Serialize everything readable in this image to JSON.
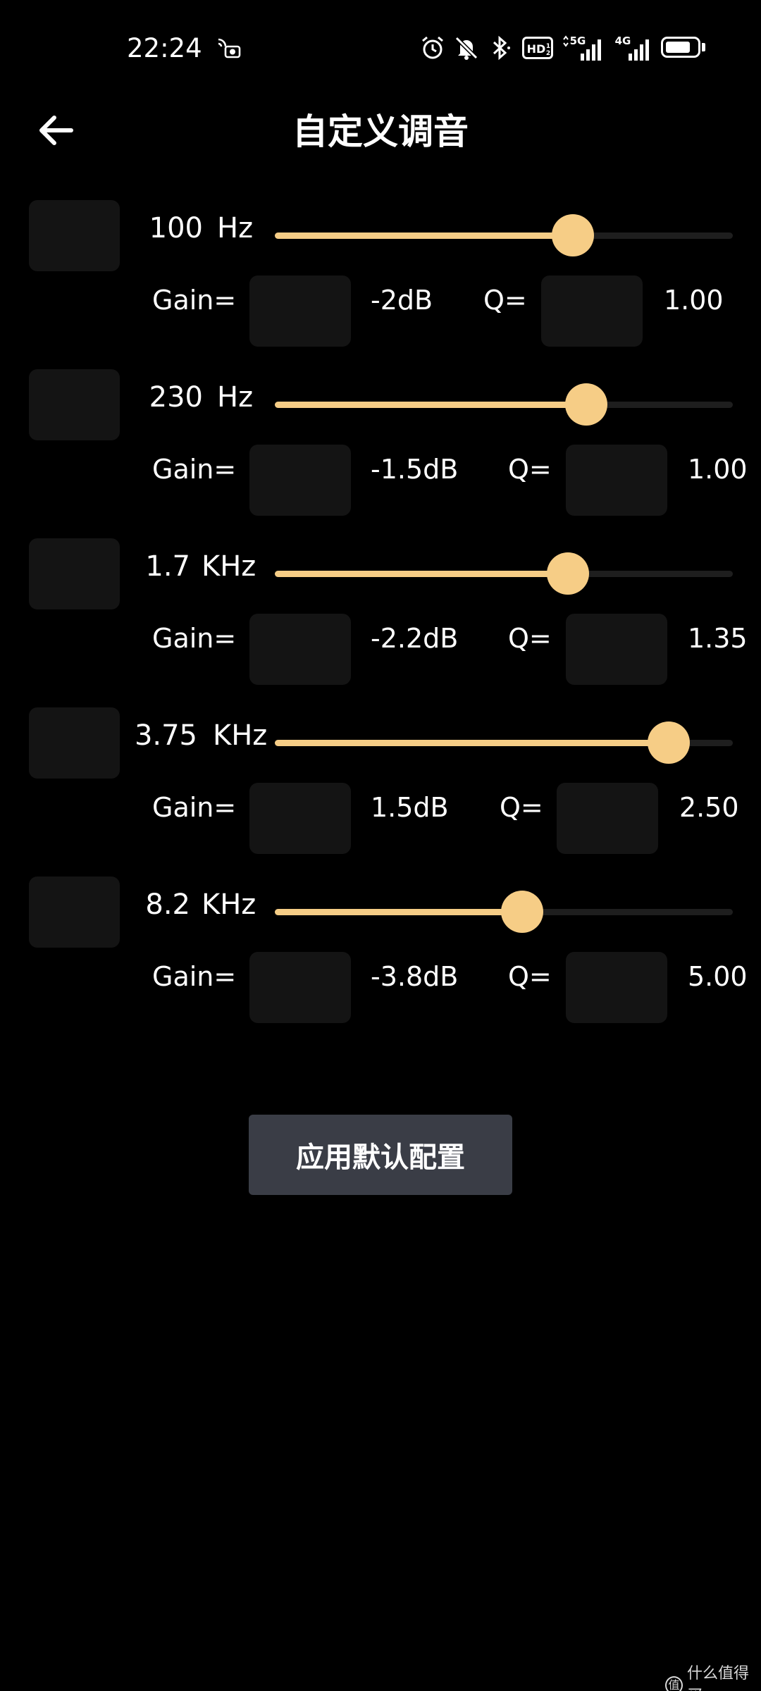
{
  "status_bar": {
    "time": "22:24",
    "icons": [
      "cast-camera-icon",
      "alarm-icon",
      "mute-icon",
      "bluetooth-icon",
      "hd-icon",
      "5g-signal-icon",
      "4g-signal-icon",
      "battery-icon"
    ],
    "hd_label": "HD",
    "net1_label": "5G",
    "net2_label": "4G",
    "battery_level": 0.8
  },
  "header": {
    "back_icon": "arrow-left-icon",
    "title": "自定义调音"
  },
  "bands": [
    {
      "freq": "100",
      "unit": "Hz",
      "slider_level": 0.65,
      "gain_label": "Gain=",
      "gain": "-2dB",
      "q_label": "Q=",
      "q": "1.00"
    },
    {
      "freq": "230",
      "unit": "Hz",
      "slider_level": 0.68,
      "gain_label": "Gain=",
      "gain": "-1.5dB",
      "q_label": "Q=",
      "q": "1.00"
    },
    {
      "freq": "1.7",
      "unit": "KHz",
      "slider_level": 0.64,
      "gain_label": "Gain=",
      "gain": "-2.2dB",
      "q_label": "Q=",
      "q": "1.35"
    },
    {
      "freq": "3.75",
      "unit": "KHz",
      "slider_level": 0.86,
      "gain_label": "Gain=",
      "gain": "1.5dB",
      "q_label": "Q=",
      "q": "2.50"
    },
    {
      "freq": "8.2",
      "unit": "KHz",
      "slider_level": 0.54,
      "gain_label": "Gain=",
      "gain": "-3.8dB",
      "q_label": "Q=",
      "q": "5.00"
    }
  ],
  "apply_button": "应用默认配置",
  "watermark": "什么值得买",
  "colors": {
    "background": "#000000",
    "accent": "#f6cd86",
    "box": "#141414",
    "button": "#3a3d46"
  }
}
